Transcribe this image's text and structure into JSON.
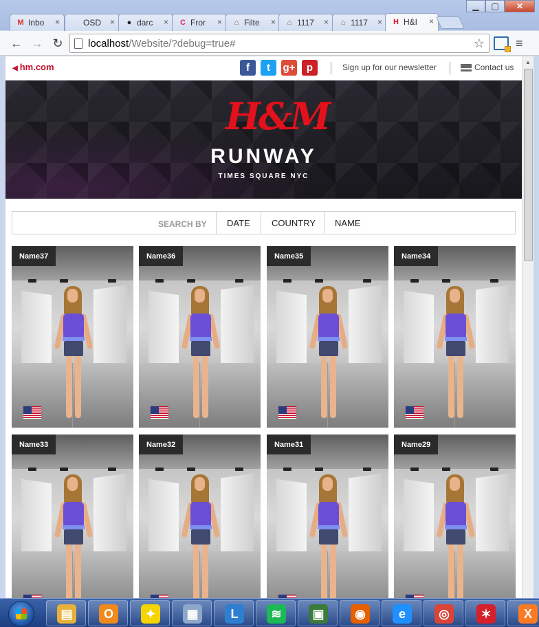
{
  "browser": {
    "tabs": [
      {
        "label": "Inbo",
        "icon": "gmail-icon",
        "color": "#d93025",
        "glyph": "M"
      },
      {
        "label": "OSD",
        "icon": "document-icon",
        "color": "#888888",
        "glyph": ""
      },
      {
        "label": "darc",
        "icon": "github-icon",
        "color": "#222222",
        "glyph": "●"
      },
      {
        "label": "Fror",
        "icon": "css-icon",
        "color": "#e0245e",
        "glyph": "C"
      },
      {
        "label": "Filte",
        "icon": "house-icon",
        "color": "#8b5a2b",
        "glyph": "⌂"
      },
      {
        "label": "1117",
        "icon": "house-icon",
        "color": "#8b5a2b",
        "glyph": "⌂"
      },
      {
        "label": "1117",
        "icon": "house-icon",
        "color": "#8b5a2b",
        "glyph": "⌂"
      },
      {
        "label": "H&I",
        "icon": "hm-icon",
        "color": "#e2111b",
        "glyph": "H"
      }
    ],
    "tab_close": "×",
    "url_host": "localhost",
    "url_path": "/Website/?debug=true#",
    "back": "←",
    "forward": "→",
    "reload": "↻",
    "star": "☆",
    "menu": "≡",
    "minimize": "▁",
    "maximize": "▢",
    "close": "✕"
  },
  "topbar": {
    "back_link": "hm.com",
    "newsletter": "Sign up for our newsletter",
    "contact": "Contact us",
    "social": [
      {
        "name": "facebook-icon",
        "glyph": "f",
        "color": "#3b5998"
      },
      {
        "name": "twitter-icon",
        "glyph": "t",
        "color": "#1da1f2"
      },
      {
        "name": "google-plus-icon",
        "glyph": "g+",
        "color": "#dd4b39"
      },
      {
        "name": "pinterest-icon",
        "glyph": "p",
        "color": "#cb2027"
      }
    ]
  },
  "banner": {
    "logo": "H&M",
    "title": "RUNWAY",
    "subtitle": "TIMES SQUARE NYC"
  },
  "filter": {
    "label": "SEARCH BY",
    "options": [
      "DATE",
      "COUNTRY",
      "NAME"
    ]
  },
  "models": [
    {
      "name": "Name37",
      "country": "usa-flag-icon"
    },
    {
      "name": "Name36",
      "country": "usa-flag-icon"
    },
    {
      "name": "Name35",
      "country": "usa-flag-icon"
    },
    {
      "name": "Name34",
      "country": "usa-flag-icon"
    },
    {
      "name": "Name33",
      "country": "usa-flag-icon"
    },
    {
      "name": "Name32",
      "country": "usa-flag-icon"
    },
    {
      "name": "Name31",
      "country": "usa-flag-icon"
    },
    {
      "name": "Name29",
      "country": "usa-flag-icon"
    }
  ],
  "taskbar": {
    "apps": [
      {
        "name": "explorer-icon",
        "glyph": "▤",
        "color": "#e8b23a"
      },
      {
        "name": "outlook-icon",
        "glyph": "O",
        "color": "#f08a1c"
      },
      {
        "name": "aim-icon",
        "glyph": "✦",
        "color": "#f5d400"
      },
      {
        "name": "calculator-icon",
        "glyph": "▦",
        "color": "#8fa7c8"
      },
      {
        "name": "lync-icon",
        "glyph": "L",
        "color": "#2f7fd0"
      },
      {
        "name": "spotify-icon",
        "glyph": "≋",
        "color": "#1db954"
      },
      {
        "name": "remote-desktop-icon",
        "glyph": "▣",
        "color": "#3b7a3b"
      },
      {
        "name": "firefox-icon",
        "glyph": "◉",
        "color": "#e66000"
      },
      {
        "name": "internet-explorer-icon",
        "glyph": "e",
        "color": "#1e90ff"
      },
      {
        "name": "chrome-icon",
        "glyph": "◎",
        "color": "#db4437"
      },
      {
        "name": "brackets-icon",
        "glyph": "✶",
        "color": "#d6202c"
      },
      {
        "name": "xampp-icon",
        "glyph": "X",
        "color": "#fb7a24"
      }
    ]
  }
}
